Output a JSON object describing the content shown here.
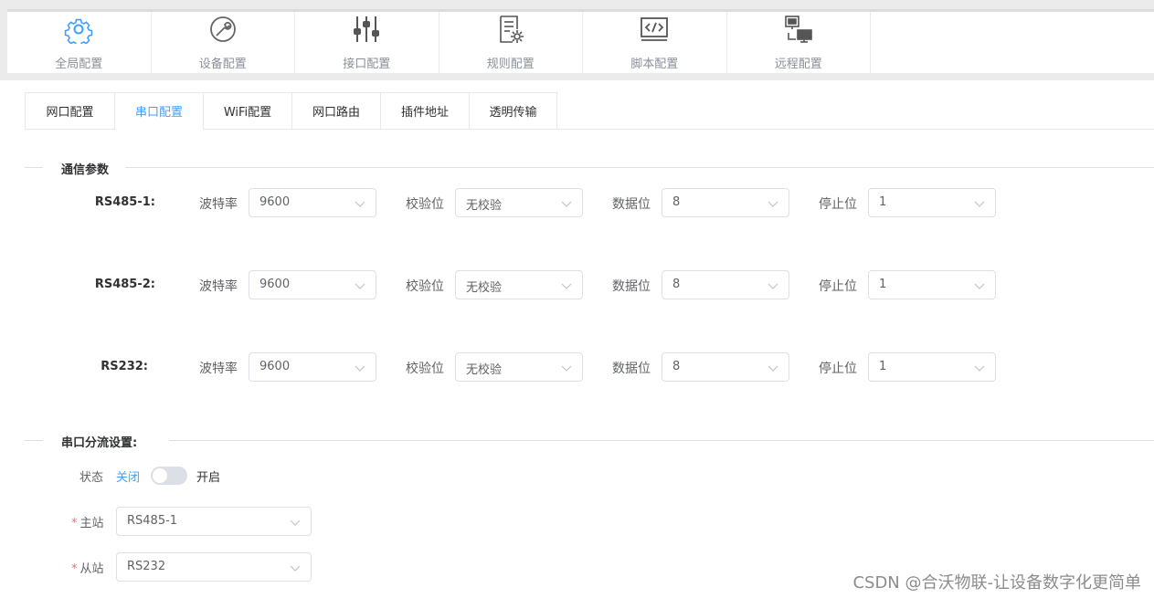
{
  "modules": [
    {
      "label": "全局配置",
      "icon": "gear-icon"
    },
    {
      "label": "设备配置",
      "icon": "wrench-icon"
    },
    {
      "label": "接口配置",
      "icon": "sliders-icon"
    },
    {
      "label": "规则配置",
      "icon": "document-gear-icon"
    },
    {
      "label": "脚本配置",
      "icon": "code-icon"
    },
    {
      "label": "远程配置",
      "icon": "remote-desktop-icon"
    }
  ],
  "tabs": [
    {
      "label": "网口配置",
      "active": false
    },
    {
      "label": "串口配置",
      "active": true
    },
    {
      "label": "WiFi配置",
      "active": false
    },
    {
      "label": "网口路由",
      "active": false
    },
    {
      "label": "插件地址",
      "active": false
    },
    {
      "label": "透明传输",
      "active": false
    }
  ],
  "comm": {
    "title": "通信参数",
    "field_labels": {
      "baud": "波特率",
      "parity": "校验位",
      "data_bits": "数据位",
      "stop_bits": "停止位"
    },
    "ports": [
      {
        "name": "RS485-1:",
        "baud": "9600",
        "parity": "无校验",
        "data_bits": "8",
        "stop_bits": "1"
      },
      {
        "name": "RS485-2:",
        "baud": "9600",
        "parity": "无校验",
        "data_bits": "8",
        "stop_bits": "1"
      },
      {
        "name": "RS232:",
        "baud": "9600",
        "parity": "无校验",
        "data_bits": "8",
        "stop_bits": "1"
      }
    ]
  },
  "split": {
    "title": "串口分流设置:",
    "state_label": "状态",
    "off_label": "关闭",
    "on_label": "开启",
    "enabled": false,
    "master_label": "主站",
    "master_value": "RS485-1",
    "slave_label": "从站",
    "slave_value": "RS232"
  },
  "colors": {
    "accent": "#409eff",
    "required": "#f56c6c"
  },
  "watermark": "CSDN @合沃物联-让设备数字化更简单"
}
